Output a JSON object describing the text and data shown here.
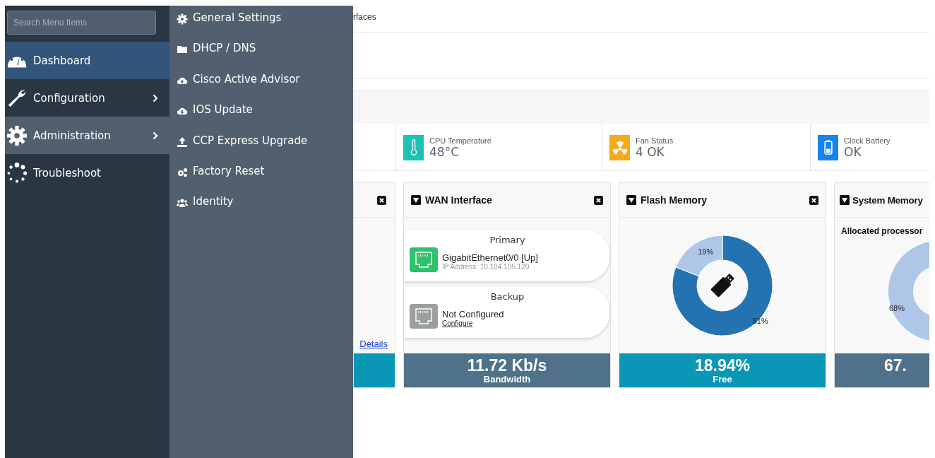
{
  "sidebar": {
    "search": {
      "placeholder": "Search Menu Items"
    },
    "items": [
      {
        "label": "Dashboard",
        "selected": true,
        "expanded": false,
        "submenu": false
      },
      {
        "label": "Configuration",
        "selected": false,
        "expanded": false,
        "submenu": true
      },
      {
        "label": "Administration",
        "selected": false,
        "expanded": true,
        "submenu": true
      },
      {
        "label": "Troubleshoot",
        "selected": false,
        "expanded": false,
        "submenu": false
      }
    ]
  },
  "submenu": {
    "items": [
      {
        "label": "General Settings"
      },
      {
        "label": "DHCP / DNS"
      },
      {
        "label": "Cisco Active Advisor"
      },
      {
        "label": "IOS Update"
      },
      {
        "label": "CCP Express Upgrade"
      },
      {
        "label": "Factory Reset"
      },
      {
        "label": "Identity"
      }
    ]
  },
  "breadcrumb": "rfaces",
  "status": [
    {
      "color": "#1cc3b5",
      "label": "CPU Temperature",
      "value": "48°C"
    },
    {
      "color": "#f7a91a",
      "label": "Fan Status",
      "value": "4 OK"
    },
    {
      "color": "#1783ef",
      "label": "Clock Battery",
      "value": "OK"
    }
  ],
  "cards": [
    {
      "kind": "partial",
      "link": "Details",
      "color": "#0a97b6"
    },
    {
      "kind": "wan",
      "title": "WAN Interface",
      "color": "#4f7189",
      "links": [
        {
          "heading": "Primary",
          "name": "GigabitEthernet0/0 [Up]",
          "detail": "IP Address: 10.104.105.120",
          "up": true
        },
        {
          "heading": "Backup",
          "name": "Not Configured",
          "action": "Configure",
          "up": false
        }
      ],
      "value": "11.72 Kb/s",
      "caption": "Bandwidth"
    },
    {
      "kind": "donut",
      "title": "Flash Memory",
      "color": "#0a97b6",
      "chart_data": {
        "type": "donut",
        "values": [
          81,
          19
        ],
        "colors": [
          "#2373b1",
          "#aec7e8"
        ],
        "value_labels": [
          "81%",
          "19%"
        ]
      },
      "value": "18.94%",
      "caption": "Free"
    },
    {
      "kind": "sysmem",
      "title": "System Memory",
      "color": "#4f7189",
      "subtitle": "Allocated processor",
      "slice_label": "68%",
      "value": "67."
    }
  ]
}
